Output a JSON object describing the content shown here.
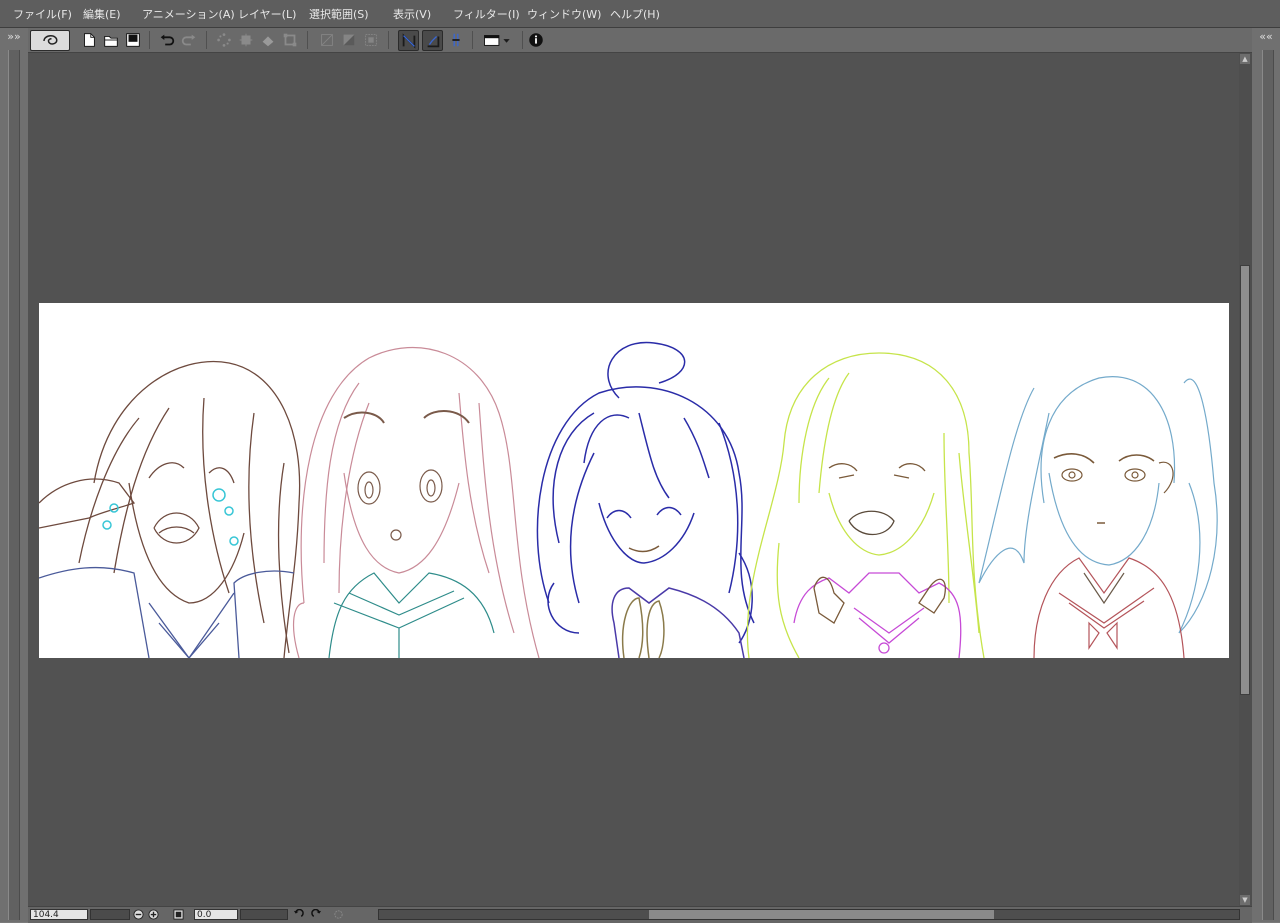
{
  "menu": {
    "file": "ファイル(F)",
    "edit": "編集(E)",
    "animation": "アニメーション(A)",
    "layer": "レイヤー(L)",
    "selection": "選択範囲(S)",
    "view": "表示(V)",
    "filter": "フィルター(I)",
    "window": "ウィンドウ(W)",
    "help": "ヘルプ(H)"
  },
  "panels": {
    "left_collapse": "»»",
    "right_collapse": "««"
  },
  "toolbar": {
    "icons": [
      "clip-studio-logo-icon",
      "new-file-icon",
      "open-file-icon",
      "save-icon",
      "undo-icon",
      "redo-icon",
      "clear-selection-icon",
      "crop-icon",
      "fill-icon",
      "transform-icon",
      "deselect-icon",
      "invert-selection-icon",
      "show-selection-icon",
      "snap-ruler-icon",
      "snap-special-ruler-icon",
      "snap-grid-icon",
      "camera-dropdown-icon",
      "info-icon"
    ]
  },
  "statusbar": {
    "zoom_value": "104.4",
    "rotation_value": "0.0"
  },
  "colors": {
    "menubar": "#5e5e5e",
    "toolbar": "#6a6a6a",
    "canvas_bg": "#525252",
    "paper": "#ffffff",
    "char1": "#6e4a3e",
    "char2": "#c98b98",
    "char2_uniform": "#2e8c8a",
    "char3": "#2a2ca8",
    "char4": "#c6e44a",
    "char4_uniform": "#c64ad6",
    "char5": "#74aacb",
    "char5_uniform": "#b4545a",
    "tear": "#38c6d6"
  }
}
